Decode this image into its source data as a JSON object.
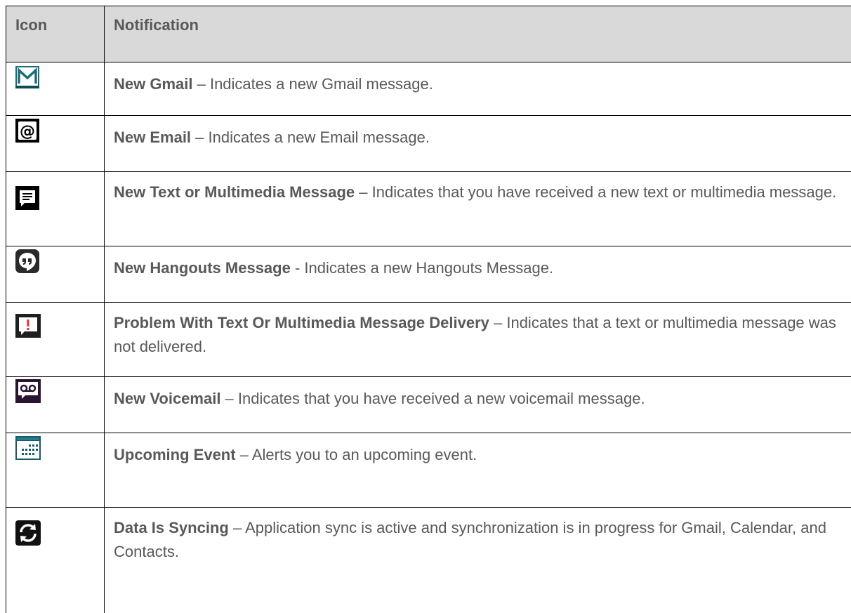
{
  "header": {
    "icon_label": "Icon",
    "notification_label": "Notification"
  },
  "rows": [
    {
      "icon": "gmail-icon",
      "title": "New Gmail",
      "separator": " – ",
      "description": "Indicates a new Gmail message."
    },
    {
      "icon": "email-at-icon",
      "title": "New Email",
      "separator": " – ",
      "description": "Indicates a new Email message."
    },
    {
      "icon": "text-message-icon",
      "title": "New Text or Multimedia Message",
      "separator": " – ",
      "description": "Indicates that you have received a new text or multimedia message."
    },
    {
      "icon": "hangouts-icon",
      "title": "New Hangouts Message",
      "separator": " - ",
      "description": "Indicates a new Hangouts Message."
    },
    {
      "icon": "message-error-icon",
      "title": "Problem With Text Or Multimedia Message Delivery",
      "separator": " – ",
      "description": "Indicates that a text or multimedia message was not delivered."
    },
    {
      "icon": "voicemail-icon",
      "title": "New Voicemail",
      "separator": " – ",
      "description": "Indicates that you have received a new voicemail message."
    },
    {
      "icon": "calendar-icon",
      "title": "Upcoming Event",
      "separator": " – ",
      "description": "Alerts you to an upcoming event."
    },
    {
      "icon": "sync-icon",
      "title": "Data Is Syncing",
      "separator": " – ",
      "description": "Application sync is active and synchronization is in progress for Gmail, Calendar, and Contacts."
    }
  ],
  "colors": {
    "header_bg": "#d9d9d9",
    "text": "#595959",
    "gmail_teal": "#1a6e7a",
    "alert_red": "#e03030"
  }
}
